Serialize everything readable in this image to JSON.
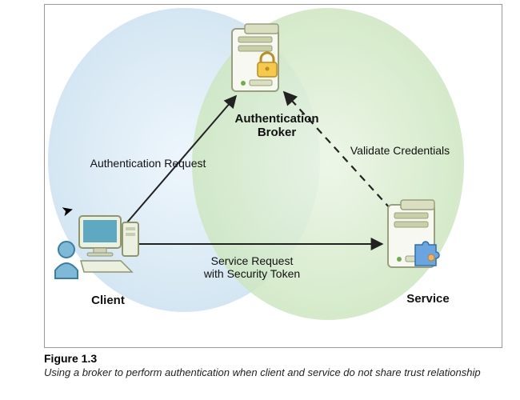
{
  "nodes": {
    "broker_label": "Authentication\nBroker",
    "client_label": "Client",
    "service_label": "Service"
  },
  "edges": {
    "auth_request": "Authentication Request",
    "validate": "Validate Credentials",
    "service_request_l1": "Service Request",
    "service_request_l2": "with Security Token"
  },
  "caption": {
    "title": "Figure 1.3",
    "text": "Using a broker to perform authentication when client and service do not share trust relationship"
  }
}
